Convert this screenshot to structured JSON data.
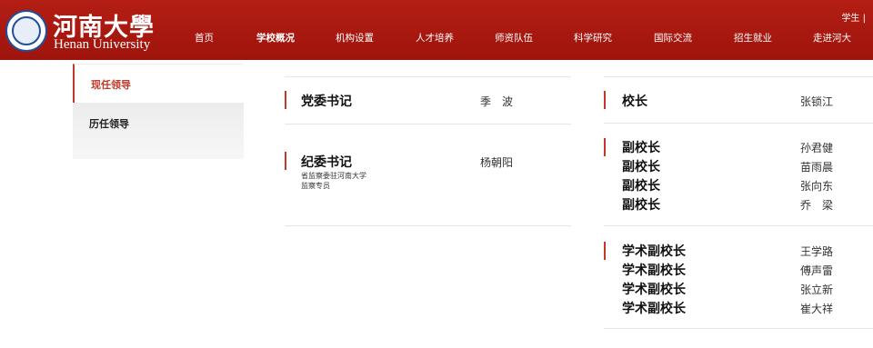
{
  "header": {
    "brand_cn": "河南大學",
    "brand_en": "Henan University",
    "top_links": "学生 |",
    "nav": [
      "首页",
      "学校概况",
      "机构设置",
      "人才培养",
      "师资队伍",
      "科学研究",
      "国际交流",
      "招生就业",
      "走进河大"
    ],
    "nav_active_index": 1,
    "bg_color": "#a8170e"
  },
  "sidebar": {
    "items": [
      "现任领导",
      "历任领导"
    ],
    "accent": "#c0392b"
  },
  "left_column": [
    {
      "title": "党委书记",
      "note": "",
      "names": [
        "季　波"
      ]
    },
    {
      "title": "纪委书记",
      "note": "省监察委驻河南大学\n监察专员",
      "names": [
        "杨朝阳"
      ]
    }
  ],
  "right_column": [
    {
      "titles": [
        "校长"
      ],
      "names": [
        "张锁江"
      ]
    },
    {
      "titles": [
        "副校长",
        "副校长",
        "副校长",
        "副校长"
      ],
      "names": [
        "孙君健",
        "苗雨晨",
        "张向东",
        "乔　梁"
      ]
    },
    {
      "titles": [
        "学术副校长",
        "学术副校长",
        "学术副校长",
        "学术副校长"
      ],
      "names": [
        "王学路",
        "傅声雷",
        "张立新",
        "崔大祥"
      ]
    }
  ]
}
